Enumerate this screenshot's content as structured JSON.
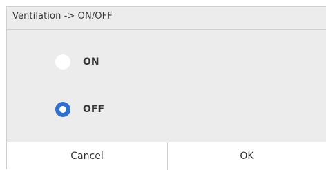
{
  "dialog": {
    "title": "Ventilation -> ON/OFF",
    "options": [
      {
        "label": "ON",
        "selected": false
      },
      {
        "label": "OFF",
        "selected": true
      }
    ],
    "buttons": {
      "cancel": "Cancel",
      "ok": "OK"
    }
  },
  "colors": {
    "accent": "#2f6fd0",
    "panel_background": "#ececec",
    "footer_background": "#ffffff",
    "text": "#333333"
  }
}
